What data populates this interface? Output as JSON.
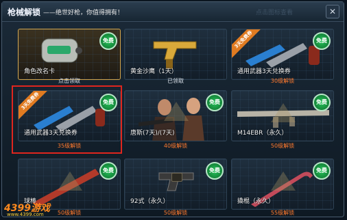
{
  "header": {
    "title": "枪械解锁",
    "subtitle": "——绝世好枪，你值得拥有！",
    "ghost_text": "点击图标查看"
  },
  "items": [
    {
      "name": "角色改名卡",
      "status": "点击领取",
      "status_type": "unlocked",
      "free": "免费",
      "ribbon": ""
    },
    {
      "name": "黄金沙鹰（1天）",
      "status": "已领取",
      "status_type": "unlocked",
      "free": "",
      "ribbon": ""
    },
    {
      "name": "通用武器3天兑换券",
      "status": "30级解锁",
      "status_type": "locked",
      "free": "免费",
      "ribbon": "3天免费券"
    },
    {
      "name": "通用武器3天兑换券",
      "status": "35级解锁",
      "status_type": "locked",
      "free": "免费",
      "ribbon": "3天免费券"
    },
    {
      "name": "唐斯(7天)/(7天)",
      "status": "40级解锁",
      "status_type": "locked",
      "free": "免费",
      "ribbon": ""
    },
    {
      "name": "M14EBR（永久）",
      "status": "50级解锁",
      "status_type": "locked",
      "free": "免费",
      "ribbon": ""
    },
    {
      "name": "球棒",
      "status": "50级解锁",
      "status_type": "locked",
      "free": "免费",
      "ribbon": ""
    },
    {
      "name": "92式（永久）",
      "status": "50级解锁",
      "status_type": "locked",
      "free": "免费",
      "ribbon": ""
    },
    {
      "name": "撬棍（永久）",
      "status": "55级解锁",
      "status_type": "locked",
      "free": "免费",
      "ribbon": ""
    }
  ],
  "logo": {
    "text": "4399游戏",
    "url_text": "www.4399.com"
  },
  "colors": {
    "accent_orange": "#ff7a2e",
    "free_green": "#1fa44a",
    "highlight_border": "#e0261e"
  }
}
